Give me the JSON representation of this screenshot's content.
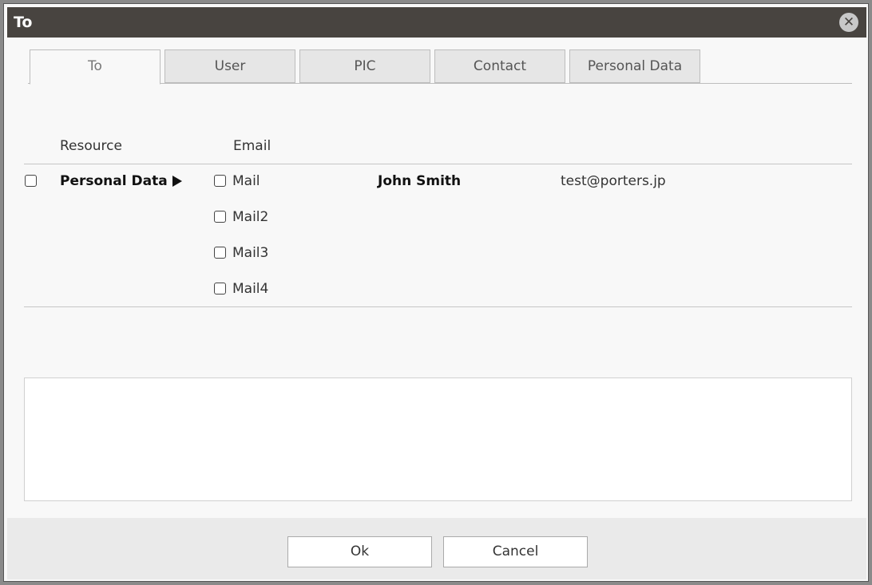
{
  "dialog": {
    "title": "To"
  },
  "tabs": [
    {
      "label": "To"
    },
    {
      "label": "User"
    },
    {
      "label": "PIC"
    },
    {
      "label": "Contact"
    },
    {
      "label": "Personal Data"
    }
  ],
  "table": {
    "headers": {
      "resource": "Resource",
      "email": "Email"
    },
    "row": {
      "resource": "Personal Data",
      "name": "John Smith",
      "email": "test@porters.jp",
      "mail_options": [
        "Mail",
        "Mail2",
        "Mail3",
        "Mail4"
      ]
    }
  },
  "footer": {
    "ok_label": "Ok",
    "cancel_label": "Cancel"
  },
  "icons": {
    "close": "close-icon",
    "expand": "triangle-right-icon"
  }
}
